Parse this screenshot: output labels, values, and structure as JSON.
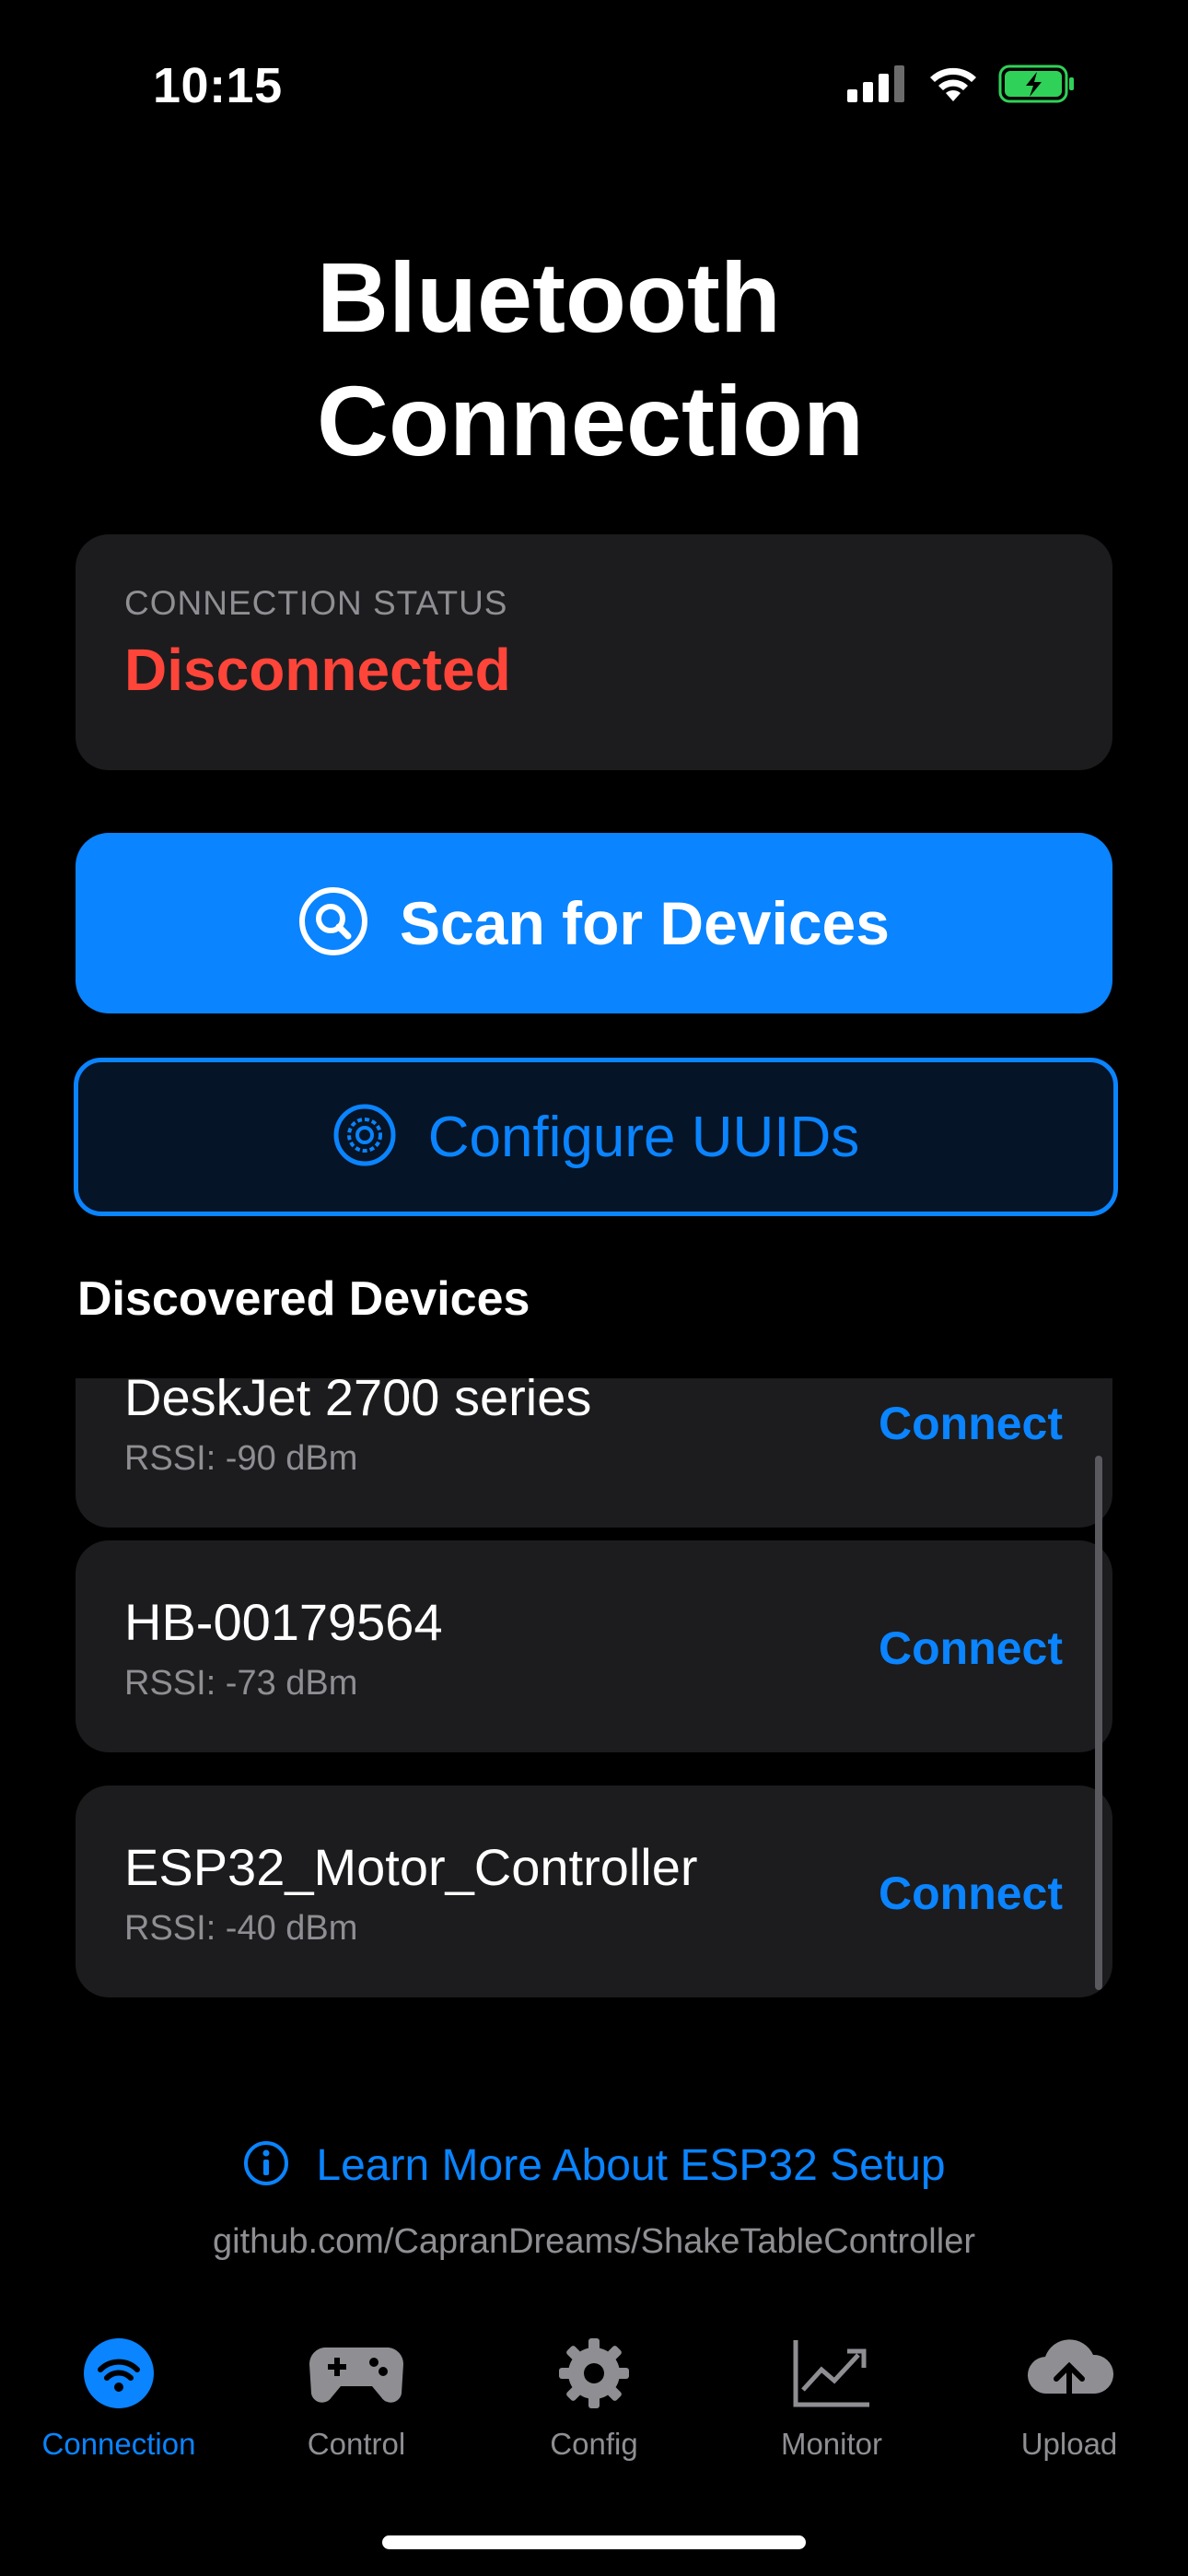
{
  "status_bar": {
    "time": "10:15",
    "icons": [
      "cellular-signal-icon",
      "wifi-icon",
      "battery-charging-icon"
    ]
  },
  "page": {
    "title": "Bluetooth Connection"
  },
  "connection_status": {
    "label": "CONNECTION STATUS",
    "value": "Disconnected",
    "value_color": "#ff453a"
  },
  "actions": {
    "scan_label": "Scan for Devices",
    "scan_icon": "magnifier-circle-icon",
    "configure_label": "Configure UUIDs",
    "configure_icon": "gear-circle-icon"
  },
  "devices": {
    "heading": "Discovered Devices",
    "items": [
      {
        "name": "DeskJet 2700 series",
        "rssi": "RSSI: -90 dBm",
        "action": "Connect"
      },
      {
        "name": "HB-00179564",
        "rssi": "RSSI: -73 dBm",
        "action": "Connect"
      },
      {
        "name": "ESP32_Motor_Controller",
        "rssi": "RSSI: -40 dBm",
        "action": "Connect"
      }
    ]
  },
  "footer": {
    "learn_more": "Learn More About ESP32 Setup",
    "learn_more_icon": "info-circle-icon",
    "github": "github.com/CapranDreams/ShakeTableController"
  },
  "tabs": [
    {
      "label": "Connection",
      "icon": "bluetooth-wave-icon",
      "active": true
    },
    {
      "label": "Control",
      "icon": "gamepad-icon",
      "active": false
    },
    {
      "label": "Config",
      "icon": "gear-icon",
      "active": false
    },
    {
      "label": "Monitor",
      "icon": "chart-line-icon",
      "active": false
    },
    {
      "label": "Upload",
      "icon": "cloud-upload-icon",
      "active": false
    }
  ],
  "colors": {
    "accent": "#0a84ff",
    "card_bg": "#1c1c1e",
    "secondary_text": "#8e8e93",
    "danger": "#ff453a",
    "battery": "#30d158"
  }
}
